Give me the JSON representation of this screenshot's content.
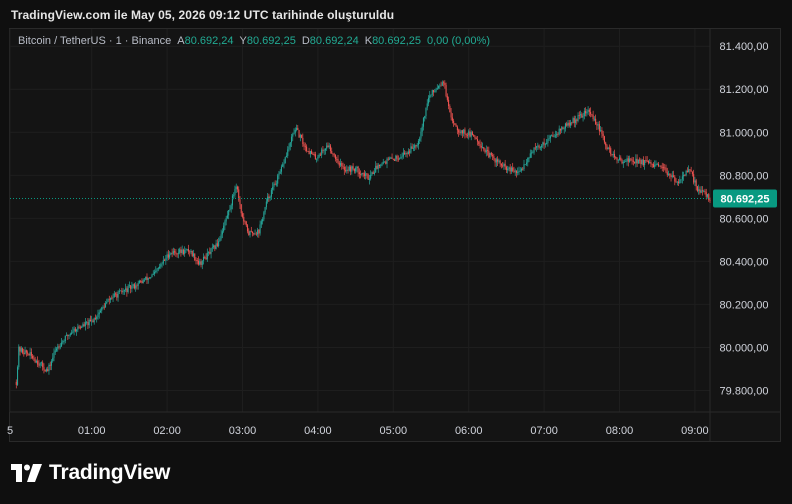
{
  "caption": "TradingView.com ile May 05, 2026 09:12 UTC tarihinde oluşturuldu",
  "legend": {
    "symbol": "Bitcoin / TetherUS · 1 · Binance",
    "a_label": "A",
    "a_value": "80.692,24",
    "y_label": "Y",
    "y_value": "80.692,25",
    "d_label": "D",
    "d_value": "80.692,24",
    "k_label": "K",
    "k_value": "80.692,25",
    "change": "0,00 (0,00%)"
  },
  "colors": {
    "up": "#26a69a",
    "down": "#ef5350",
    "price_label_bg": "#089981",
    "background": "#141414"
  },
  "brand": {
    "name": "TradingView",
    "icon": "tradingview-logo-icon"
  },
  "chart_data": {
    "type": "candlestick",
    "y_ticks": [
      "81.400,00",
      "81.200,00",
      "81.000,00",
      "80.800,00",
      "80.600,00",
      "80.400,00",
      "80.200,00",
      "80.000,00",
      "79.800,00"
    ],
    "y_tick_values": [
      81400,
      81200,
      81000,
      80800,
      80600,
      80400,
      80200,
      80000,
      79800
    ],
    "x_ticks": [
      "5",
      "01:00",
      "02:00",
      "03:00",
      "04:00",
      "05:00",
      "06:00",
      "07:00",
      "08:00",
      "09:00"
    ],
    "x_tick_minutes": [
      -5,
      60,
      120,
      180,
      240,
      300,
      360,
      420,
      480,
      540
    ],
    "x_range_minutes": [
      -5,
      552
    ],
    "ylim": [
      79700,
      81480
    ],
    "last_price": 80692.25,
    "last_price_label": "80.692,25",
    "path_keypoints": [
      [
        0,
        79840
      ],
      [
        2,
        79990
      ],
      [
        10,
        79970
      ],
      [
        25,
        79890
      ],
      [
        32,
        80000
      ],
      [
        45,
        80080
      ],
      [
        60,
        80120
      ],
      [
        75,
        80230
      ],
      [
        95,
        80290
      ],
      [
        110,
        80340
      ],
      [
        122,
        80440
      ],
      [
        138,
        80450
      ],
      [
        146,
        80390
      ],
      [
        160,
        80480
      ],
      [
        170,
        80650
      ],
      [
        175,
        80760
      ],
      [
        180,
        80600
      ],
      [
        185,
        80530
      ],
      [
        193,
        80540
      ],
      [
        200,
        80690
      ],
      [
        210,
        80810
      ],
      [
        218,
        80950
      ],
      [
        222,
        81020
      ],
      [
        230,
        80930
      ],
      [
        238,
        80880
      ],
      [
        248,
        80940
      ],
      [
        260,
        80830
      ],
      [
        270,
        80830
      ],
      [
        280,
        80790
      ],
      [
        290,
        80860
      ],
      [
        302,
        80880
      ],
      [
        312,
        80910
      ],
      [
        320,
        80960
      ],
      [
        328,
        81160
      ],
      [
        336,
        81220
      ],
      [
        340,
        81240
      ],
      [
        345,
        81080
      ],
      [
        352,
        81010
      ],
      [
        365,
        80980
      ],
      [
        375,
        80900
      ],
      [
        390,
        80830
      ],
      [
        400,
        80810
      ],
      [
        410,
        80910
      ],
      [
        420,
        80950
      ],
      [
        430,
        81000
      ],
      [
        440,
        81040
      ],
      [
        450,
        81080
      ],
      [
        455,
        81100
      ],
      [
        462,
        81040
      ],
      [
        470,
        80930
      ],
      [
        478,
        80870
      ],
      [
        490,
        80870
      ],
      [
        500,
        80860
      ],
      [
        510,
        80840
      ],
      [
        520,
        80810
      ],
      [
        525,
        80760
      ],
      [
        530,
        80800
      ],
      [
        536,
        80820
      ],
      [
        542,
        80740
      ],
      [
        552,
        80692
      ]
    ]
  }
}
